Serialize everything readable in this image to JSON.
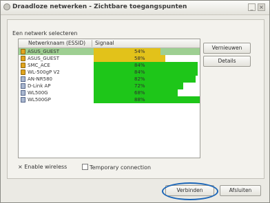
{
  "window": {
    "title": "Draadloze netwerken - Zichtbare toegangspunten",
    "close_label": "×",
    "min_label": "_"
  },
  "panel": {
    "select_label": "Een netwerk selecteren"
  },
  "list": {
    "columns": [
      "Netwerknaam (ESSID)",
      "Signaal"
    ],
    "rows": [
      {
        "ssid": "ASUS_GUEST",
        "signal": 54,
        "signal_text": "54%",
        "security": "lock",
        "color": "#e2c21a",
        "selected": true
      },
      {
        "ssid": "ASUS_GUEST",
        "signal": 58,
        "signal_text": "58%",
        "security": "lock",
        "color": "#e2c21a",
        "selected": false
      },
      {
        "ssid": "SMC_ACE",
        "signal": 84,
        "signal_text": "84%",
        "security": "lock",
        "color": "#1ec619",
        "selected": false
      },
      {
        "ssid": "WL-500gP V2",
        "signal": 84,
        "signal_text": "84%",
        "security": "lock",
        "color": "#1ec619",
        "selected": false
      },
      {
        "ssid": "AN-NR580",
        "signal": 82,
        "signal_text": "82%",
        "security": "open",
        "color": "#1ec619",
        "selected": false
      },
      {
        "ssid": "D-Link AP",
        "signal": 72,
        "signal_text": "72%",
        "security": "open",
        "color": "#1ec619",
        "selected": false
      },
      {
        "ssid": "WL500G",
        "signal": 68,
        "signal_text": "68%",
        "security": "open",
        "color": "#1ec619",
        "selected": false
      },
      {
        "ssid": "WL500GP",
        "signal": 88,
        "signal_text": "88%",
        "security": "open",
        "color": "#1ec619",
        "selected": false
      }
    ]
  },
  "side_buttons": {
    "refresh": "Vernieuwen",
    "details": "Details"
  },
  "checkboxes": {
    "enable_wireless": {
      "label": "Enable wireless",
      "mark": "×"
    },
    "temporary": {
      "label": "Temporary connection"
    }
  },
  "footer": {
    "connect": "Verbinden",
    "cancel": "Afsluiten"
  }
}
